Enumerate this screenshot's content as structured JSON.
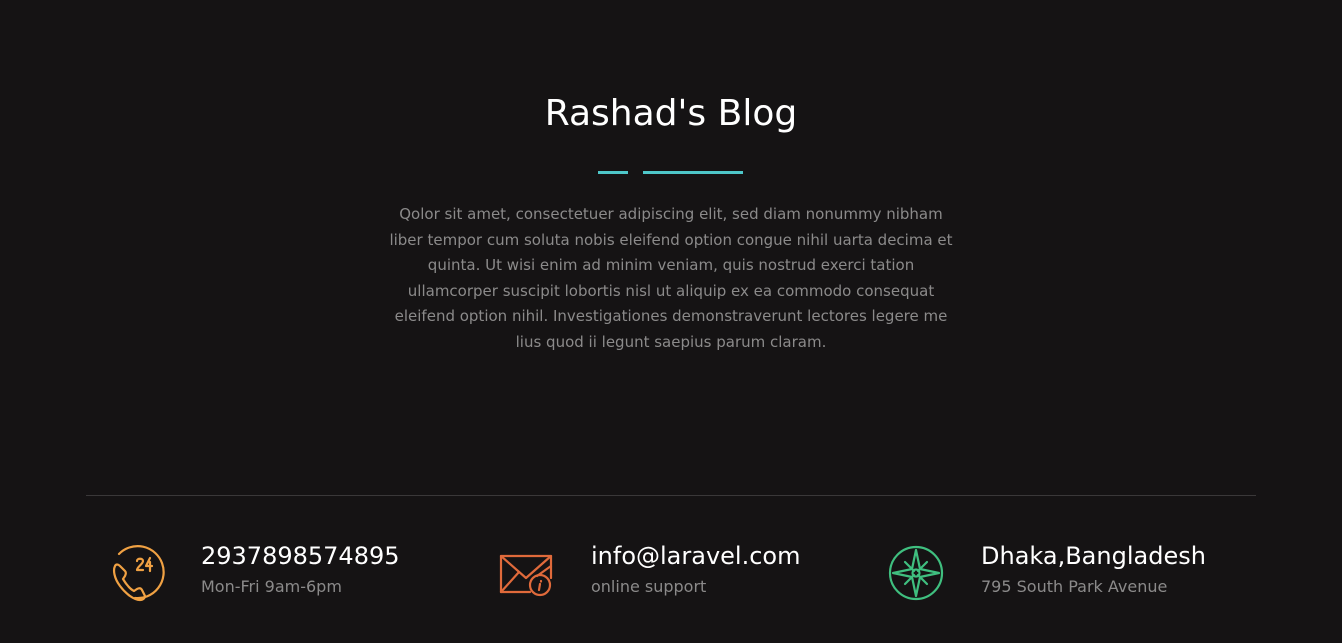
{
  "header": {
    "title": "Rashad's Blog",
    "accent_color": "#4ec7c9"
  },
  "intro": {
    "text": "Qolor sit amet, consectetuer adipiscing elit, sed diam nonummy nibham liber tempor cum soluta nobis eleifend option congue nihil uarta decima et quinta. Ut wisi enim ad minim veniam, quis nostrud exerci tation ullamcorper suscipit lobortis nisl ut aliquip ex ea commodo consequat eleifend option nihil. Investigationes demonstraverunt lectores legere me lius quod ii legunt saepius parum claram."
  },
  "contacts": [
    {
      "icon": "phone-24-icon",
      "icon_color": "#f0a143",
      "value": "2937898574895",
      "caption": "Mon-Fri 9am-6pm"
    },
    {
      "icon": "mail-info-icon",
      "icon_color": "#e06a3b",
      "value": "info@laravel.com",
      "caption": "online support"
    },
    {
      "icon": "compass-icon",
      "icon_color": "#3fbf7f",
      "value": "Dhaka,Bangladesh",
      "caption": "795 South Park Avenue"
    }
  ]
}
